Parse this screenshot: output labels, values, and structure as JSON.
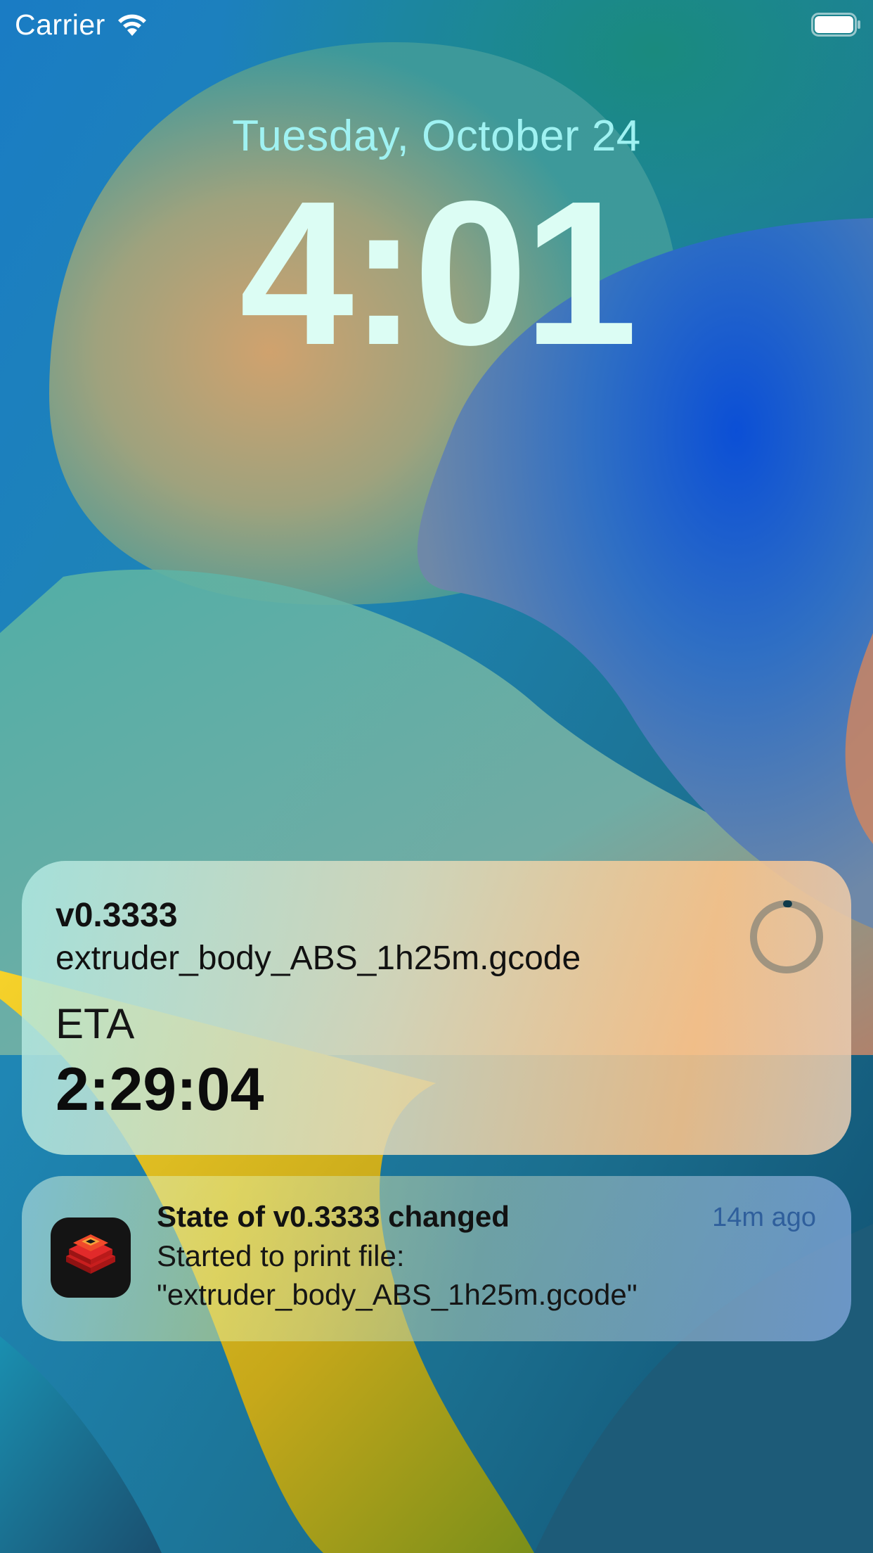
{
  "status_bar": {
    "carrier": "Carrier",
    "wifi_icon": "wifi-icon",
    "battery_icon": "battery-icon"
  },
  "lock_screen": {
    "date": "Tuesday, October 24",
    "time": "4:01"
  },
  "live_activity": {
    "printer_name": "v0.3333",
    "filename": "extruder_body_ABS_1h25m.gcode",
    "eta_label": "ETA",
    "eta_value": "2:29:04",
    "progress_fraction": 0.01,
    "progress_icon": "progress-ring-icon"
  },
  "notification": {
    "app_icon": "printer-app-icon",
    "title": "State of v0.3333 changed",
    "time": "14m ago",
    "body_line1": "Started to print file:",
    "body_line2": "\"extruder_body_ABS_1h25m.gcode\""
  },
  "colors": {
    "date_text": "#9ff2f2",
    "time_text": "#dcfdf4",
    "notif_time": "#2f5f9c",
    "app_icon_bg": "#141414",
    "app_icon_red": "#e02424"
  }
}
